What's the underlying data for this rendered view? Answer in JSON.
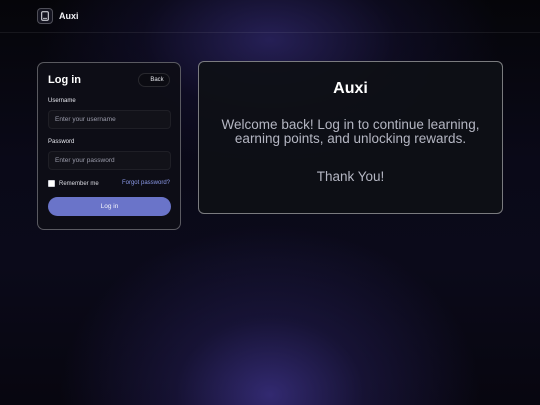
{
  "header": {
    "brand_name": "Auxi",
    "brand_icon": "book-icon"
  },
  "login": {
    "title": "Log in",
    "back_label": "Back",
    "username_label": "Username",
    "username_placeholder": "Enter your username",
    "username_value": "",
    "password_label": "Password",
    "password_placeholder": "Enter your password",
    "password_value": "",
    "remember_label": "Remember me",
    "remember_checked": false,
    "forgot_label": "Forgot password?",
    "submit_label": "Log in"
  },
  "welcome": {
    "brand": "Auxi",
    "message": "Welcome back! Log in to continue learning, earning points, and unlocking rewards.",
    "thanks": "Thank You!"
  },
  "colors": {
    "accent_button": "#6a74c9",
    "link": "#8a98e6",
    "background_glow": "#3a3082"
  }
}
